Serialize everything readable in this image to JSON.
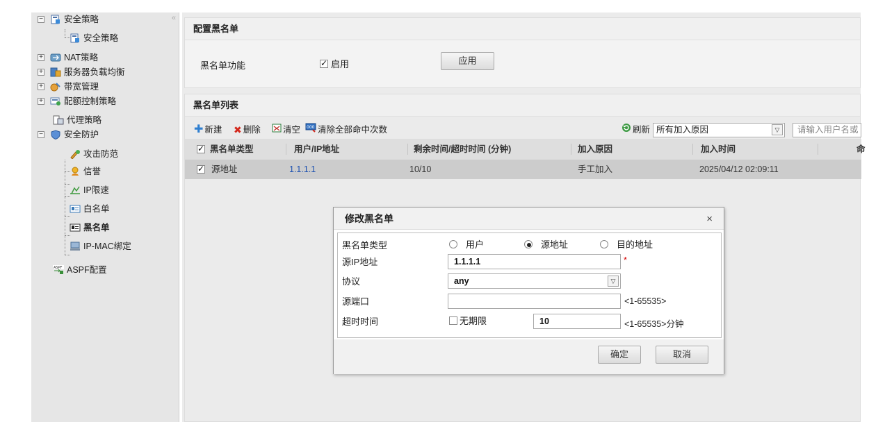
{
  "sidebar": {
    "collapse_glyph": "«",
    "items": [
      {
        "label": "安全策略",
        "icon": "policy-doc-icon",
        "expander": "−"
      },
      {
        "label": "安全策略",
        "icon": "policy-doc-icon"
      },
      {
        "label": "NAT策略",
        "icon": "nat-icon",
        "expander": "+"
      },
      {
        "label": "服务器负载均衡",
        "icon": "server-icon",
        "expander": "+"
      },
      {
        "label": "带宽管理",
        "icon": "bandwidth-icon",
        "expander": "+"
      },
      {
        "label": "配额控制策略",
        "icon": "quota-icon",
        "expander": "+"
      },
      {
        "label": "代理策略",
        "icon": "proxy-icon"
      },
      {
        "label": "安全防护",
        "icon": "shield-icon",
        "expander": "−"
      },
      {
        "label": "攻击防范",
        "icon": "attack-defense-icon"
      },
      {
        "label": "信誉",
        "icon": "reputation-icon"
      },
      {
        "label": "IP限速",
        "icon": "ip-rate-limit-icon"
      },
      {
        "label": "白名单",
        "icon": "whitelist-icon"
      },
      {
        "label": "黑名单",
        "icon": "blacklist-icon"
      },
      {
        "label": "IP-MAC绑定",
        "icon": "ip-mac-bind-icon"
      },
      {
        "label": "ASPF配置",
        "icon": "aspf-icon"
      }
    ]
  },
  "config_panel": {
    "title": "配置黑名单",
    "function_label": "黑名单功能",
    "enable_label": "启用",
    "enable_checked": true,
    "apply_button": "应用"
  },
  "list_panel": {
    "title": "黑名单列表",
    "toolbar": {
      "new_label": "新建",
      "delete_label": "删除",
      "clear_label": "清空",
      "clear_hits_label": "清除全部命中次数",
      "refresh_label": "刷新",
      "reason_filter_value": "所有加入原因",
      "search_placeholder": "请输入用户名或"
    },
    "columns": [
      "黑名单类型",
      "用户/IP地址",
      "剩余时间/超时时间 (分钟)",
      "加入原因",
      "加入时间",
      "命"
    ],
    "rows": [
      {
        "type": "源地址",
        "address": "1.1.1.1",
        "time": "10/10",
        "reason": "手工加入",
        "added": "2025/04/12 02:09:11",
        "checked": true
      }
    ]
  },
  "dialog": {
    "title": "修改黑名单",
    "close_glyph": "×",
    "type_label": "黑名单类型",
    "type_options": [
      "用户",
      "源地址",
      "目的地址"
    ],
    "type_selected": "源地址",
    "src_ip_label": "源IP地址",
    "src_ip_value": "1.1.1.1",
    "required_mark": "*",
    "protocol_label": "协议",
    "protocol_value": "any",
    "src_port_label": "源端口",
    "src_port_value": "",
    "src_port_hint": "<1-65535>",
    "timeout_label": "超时时间",
    "no_limit_label": "无期限",
    "no_limit_checked": false,
    "timeout_value": "10",
    "timeout_hint": "<1-65535>分钟",
    "ok_button": "确定",
    "cancel_button": "取消"
  },
  "colors": {
    "link_blue": "#1a4fb0",
    "required_red": "#d40000",
    "selected_row": "#cccccc"
  }
}
